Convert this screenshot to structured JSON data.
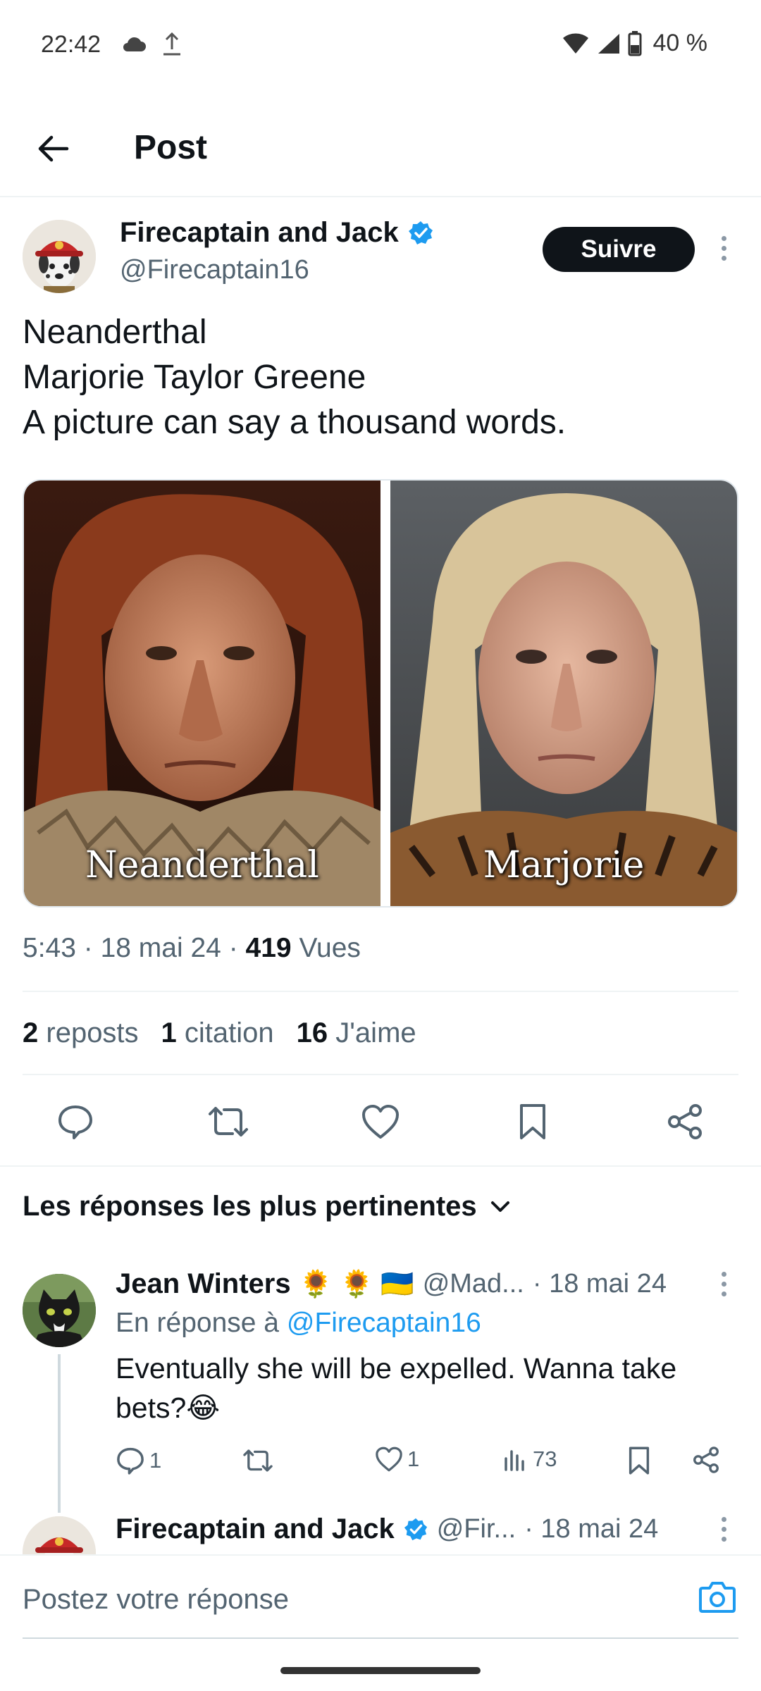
{
  "status_bar": {
    "time": "22:42",
    "battery": "40 %",
    "icons": [
      "cloud-icon",
      "upload-icon",
      "wifi-icon",
      "signal-icon",
      "battery-icon"
    ]
  },
  "header": {
    "title": "Post",
    "back_icon": "arrow-left-icon"
  },
  "post": {
    "author_name": "Firecaptain and Jack",
    "author_handle": "@Firecaptain16",
    "verified": true,
    "follow_label": "Suivre",
    "text_lines": [
      "Neanderthal",
      "Marjorie Taylor Greene",
      "A picture can say a thousand words."
    ],
    "media": {
      "left_caption": "Neanderthal",
      "right_caption": "Marjorie"
    },
    "time": "5:43",
    "date": "18 mai 24",
    "views_count": "419",
    "views_label": "Vues",
    "reposts_count": "2",
    "reposts_label": "reposts",
    "quotes_count": "1",
    "quotes_label": "citation",
    "likes_count": "16",
    "likes_label": "J'aime"
  },
  "actions": [
    "reply-icon",
    "repost-icon",
    "like-icon",
    "bookmark-icon",
    "share-icon"
  ],
  "replies_sort_label": "Les réponses les plus pertinentes",
  "reply": {
    "name": "Jean Winters",
    "emojis": "🌻 🌻 🇺🇦",
    "handle": "@Mad...",
    "date": "· 18 mai 24",
    "in_reply_prefix": "En réponse à",
    "in_reply_handle": "@Firecaptain16",
    "text": "Eventually she will be expelled. Wanna take bets?😂",
    "reply_count": "1",
    "like_count": "1",
    "views_count": "73"
  },
  "reply2": {
    "name": "Firecaptain and Jack",
    "handle": "@Fir...",
    "date": "· 18 mai 24"
  },
  "composer": {
    "placeholder": "Postez votre réponse"
  },
  "colors": {
    "accent": "#1d9bf0",
    "text": "#0f1419",
    "secondary": "#536471",
    "follow_bg": "#0f1419"
  }
}
